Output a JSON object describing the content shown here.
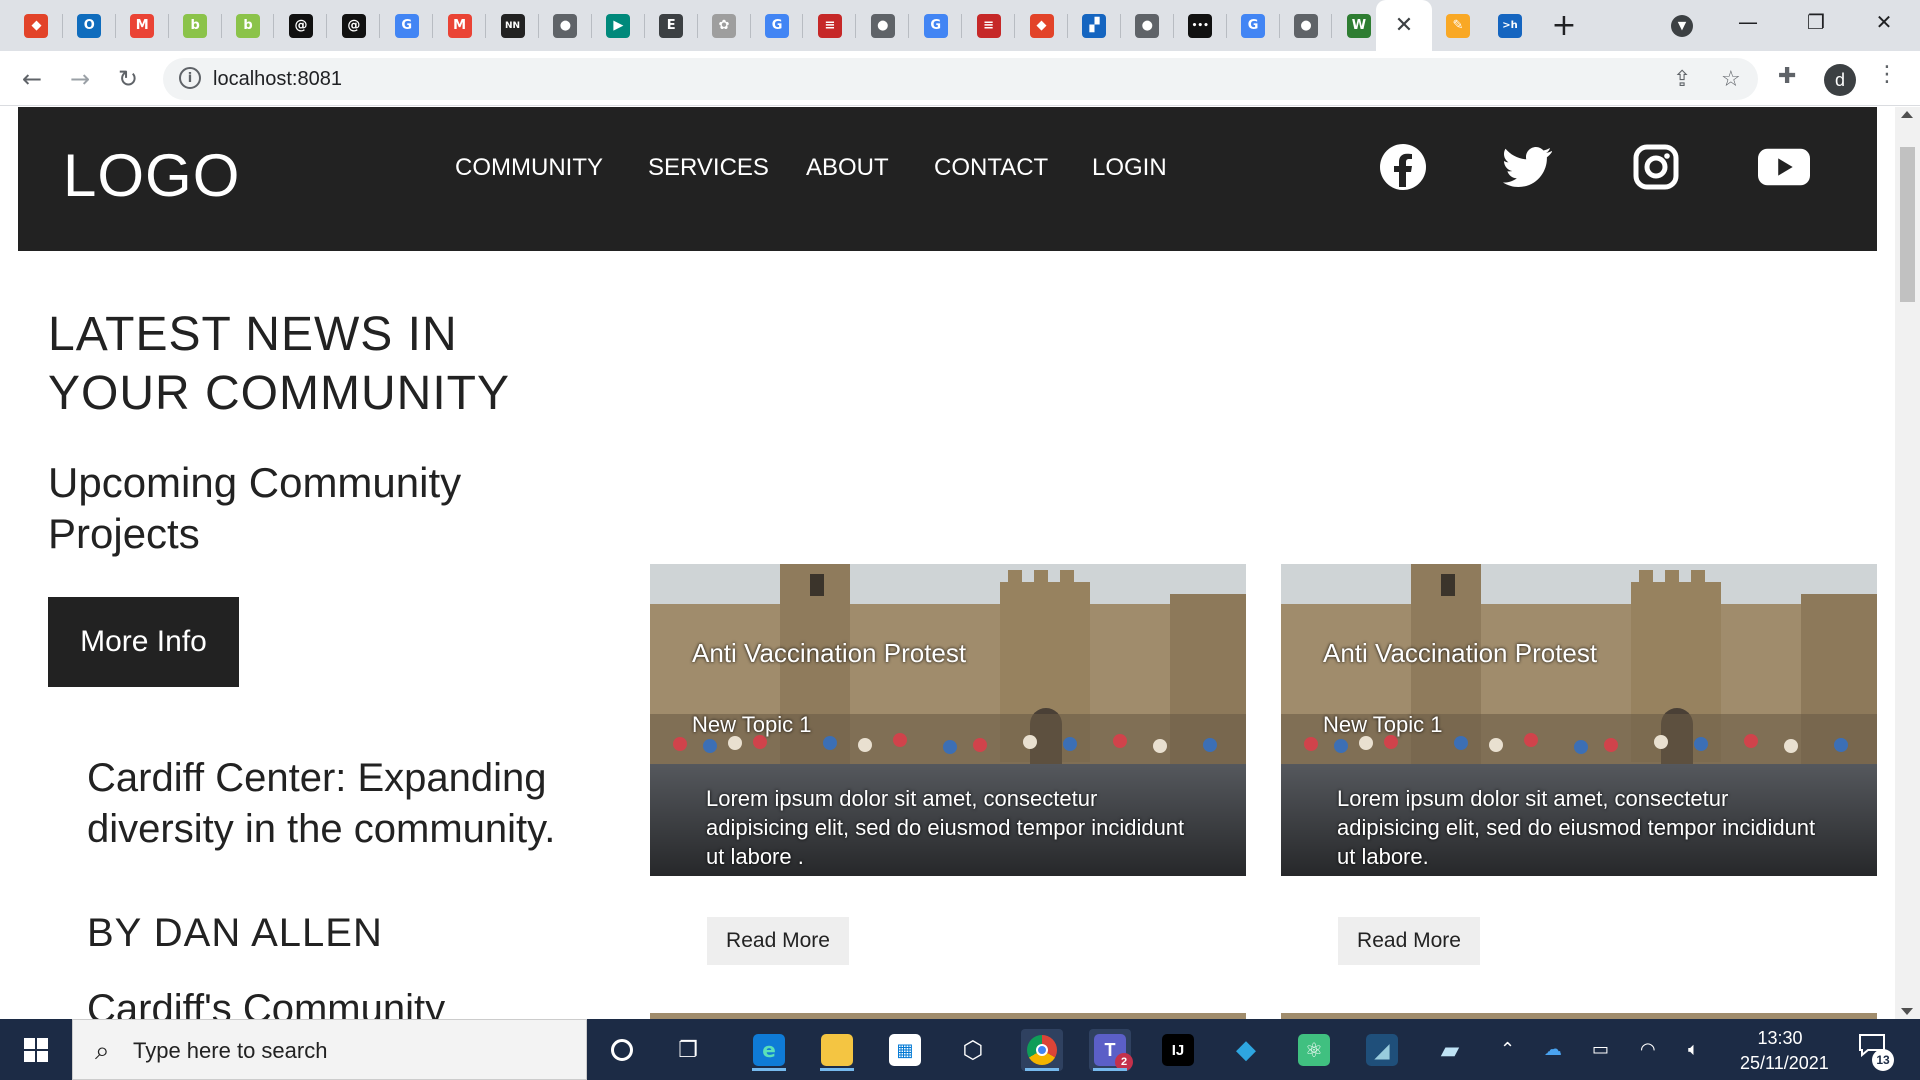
{
  "browser": {
    "tabs": [
      {
        "icon": "gitlab-icon",
        "color": "#e24329",
        "glyph": "◆"
      },
      {
        "icon": "outlook-icon",
        "color": "#0f6cbd",
        "glyph": "O"
      },
      {
        "icon": "gmail-icon",
        "color": "#ea4335",
        "glyph": "M"
      },
      {
        "icon": "green-app-icon",
        "color": "#8bc34a",
        "glyph": "b"
      },
      {
        "icon": "green-app-icon",
        "color": "#8bc34a",
        "glyph": "b"
      },
      {
        "icon": "spiral-icon",
        "color": "#111111",
        "glyph": "@"
      },
      {
        "icon": "spiral-icon",
        "color": "#111111",
        "glyph": "@"
      },
      {
        "icon": "google-icon",
        "color": "#4285f4",
        "glyph": "G"
      },
      {
        "icon": "gmail-icon",
        "color": "#ea4335",
        "glyph": "M"
      },
      {
        "icon": "nn-icon",
        "color": "#222222",
        "glyph": "NN"
      },
      {
        "icon": "globe-icon",
        "color": "#5f6368",
        "glyph": "●"
      },
      {
        "icon": "meet-icon",
        "color": "#00897b",
        "glyph": "▶"
      },
      {
        "icon": "doc-icon",
        "color": "#3c4043",
        "glyph": "E"
      },
      {
        "icon": "flower-icon",
        "color": "#9e9e9e",
        "glyph": "✿"
      },
      {
        "icon": "google-icon",
        "color": "#4285f4",
        "glyph": "G"
      },
      {
        "icon": "red-book-icon",
        "color": "#c62828",
        "glyph": "≡"
      },
      {
        "icon": "globe-icon",
        "color": "#5f6368",
        "glyph": "●"
      },
      {
        "icon": "google-icon",
        "color": "#4285f4",
        "glyph": "G"
      },
      {
        "icon": "red-book-icon",
        "color": "#c62828",
        "glyph": "≡"
      },
      {
        "icon": "gitlab-icon",
        "color": "#e24329",
        "glyph": "◆"
      },
      {
        "icon": "blocks-icon",
        "color": "#1565c0",
        "glyph": "▞"
      },
      {
        "icon": "globe-icon",
        "color": "#5f6368",
        "glyph": "●"
      },
      {
        "icon": "dots-icon",
        "color": "#111111",
        "glyph": "•••"
      },
      {
        "icon": "google-icon",
        "color": "#4285f4",
        "glyph": "G"
      },
      {
        "icon": "globe-icon",
        "color": "#5f6368",
        "glyph": "●"
      },
      {
        "icon": "w-icon",
        "color": "#2e7d32",
        "glyph": "W"
      }
    ],
    "after_active_tabs": [
      {
        "icon": "sticky-note-icon",
        "color": "#f9a825",
        "glyph": "✎"
      },
      {
        "icon": "terminal-icon",
        "color": "#1565c0",
        "glyph": ">h"
      }
    ],
    "url": "localhost:8081",
    "profile_initial": "d"
  },
  "site": {
    "logo": "LOGO",
    "nav": [
      "COMMUNITY",
      "SERVICES",
      "ABOUT",
      "CONTACT",
      "LOGIN"
    ],
    "social": [
      "facebook-icon",
      "twitter-icon",
      "instagram-icon",
      "youtube-icon"
    ],
    "headline": "LATEST NEWS IN YOUR COMMUNITY",
    "subheadline": "Upcoming Community Projects",
    "more_info": "More Info",
    "article": {
      "title": "Cardiff Center: Expanding diversity in the community.",
      "author": "BY DAN ALLEN",
      "next_title": "Cardiff's Community"
    },
    "cards": [
      {
        "title": "Anti Vaccination Protest",
        "topic": "New Topic 1",
        "body": "Lorem ipsum dolor sit amet, consectetur adipisicing elit, sed do eiusmod tempor incididunt ut labore .",
        "button": "Read More"
      },
      {
        "title": "Anti Vaccination Protest",
        "topic": "New Topic 1",
        "body": "Lorem ipsum dolor sit amet, consectetur adipisicing elit, sed do eiusmod tempor incididunt ut labore.",
        "button": "Read More"
      }
    ]
  },
  "taskbar": {
    "search_placeholder": "Type here to search",
    "apps": [
      "cortana-icon",
      "task-view-icon",
      "edge-icon",
      "file-explorer-icon",
      "store-icon",
      "dev-tool-icon",
      "chrome-icon",
      "teams-icon",
      "intellij-icon",
      "sourcetree-icon",
      "atom-icon",
      "vscode-icon",
      "notes-icon"
    ],
    "teams_badge": "2",
    "time": "13:30",
    "date": "25/11/2021",
    "notifications": "13"
  },
  "colors": {
    "header_bg": "#222222",
    "taskbar_bg": "#1c2b45",
    "accent": "#76b9ed"
  }
}
